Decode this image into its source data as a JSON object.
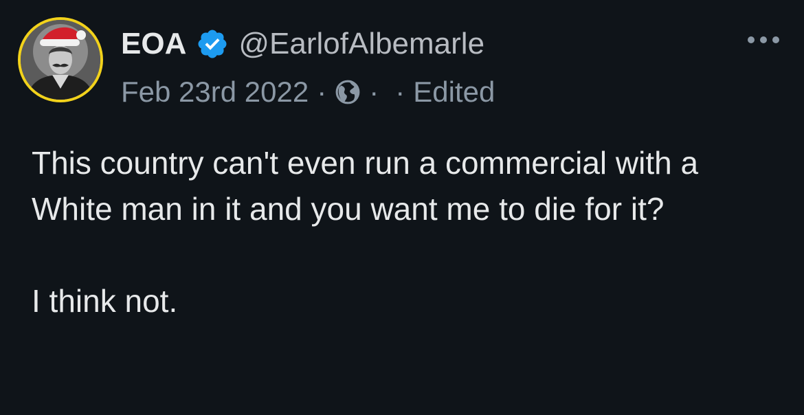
{
  "author": {
    "display_name": "EOA",
    "handle": "@EarlofAlbemarle",
    "verified": true,
    "avatar_description_icon": "avatar-santa-hat"
  },
  "meta": {
    "date": "Feb 23rd 2022",
    "separator": "·",
    "audience_icon": "globe-icon",
    "edited_label": "Edited"
  },
  "menu": {
    "icon": "more-options-icon"
  },
  "content": {
    "paragraphs": [
      "This country can't even run a commercial with a White man in it and you want me to die for it?",
      "I think not."
    ]
  },
  "colors": {
    "background": "#0f1419",
    "primary_text": "#e7e9ea",
    "secondary_text": "#8b98a5",
    "verified_blue": "#1d9bf0",
    "avatar_ring": "#f2d21b"
  }
}
